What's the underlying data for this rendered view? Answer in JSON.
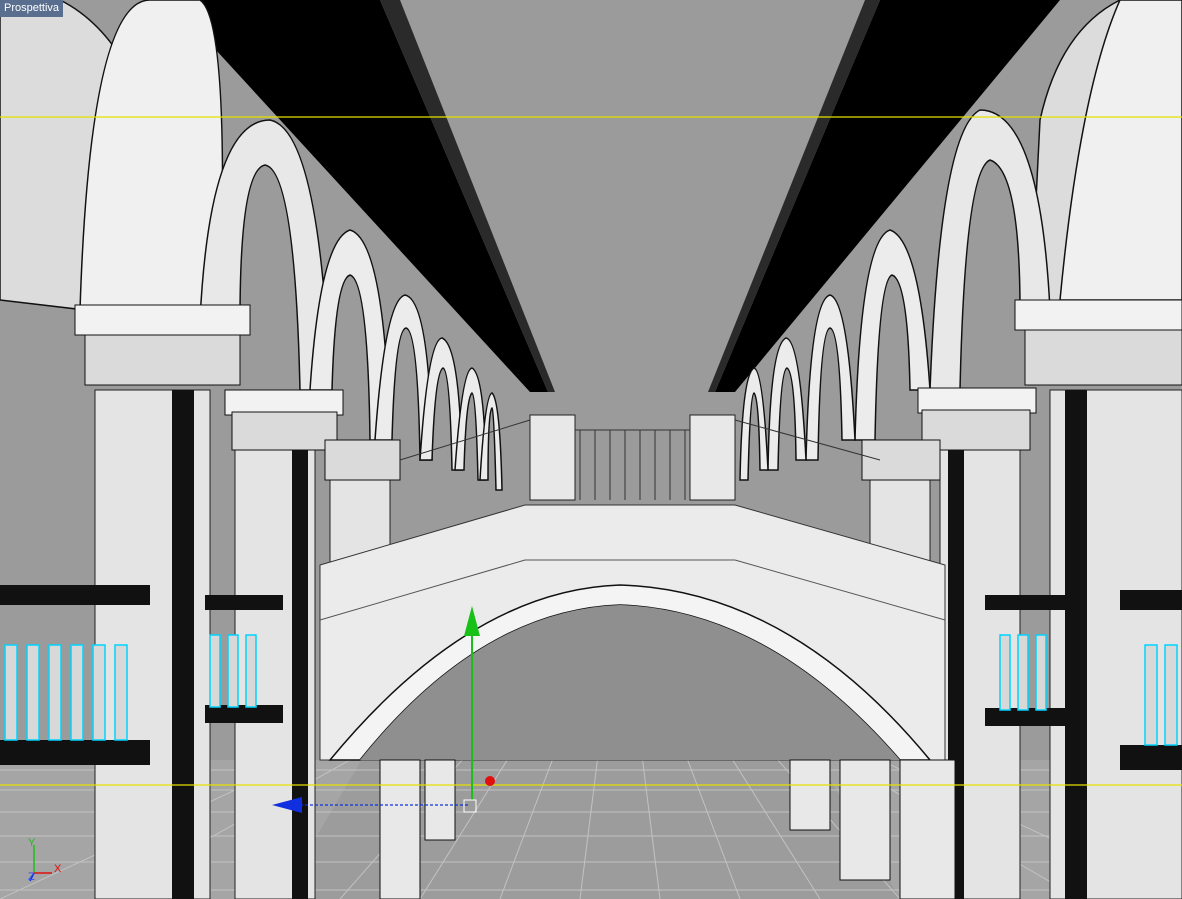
{
  "viewport": {
    "label": "Prospettiva",
    "background": "#9a9a9a",
    "safe_frame_color": "#e5e000"
  },
  "scene": {
    "ceiling_shadow": "#000000",
    "stone": "#e8e8e8",
    "grid_color": "#bdbdbd",
    "baluster_highlight": "#00d4ff"
  },
  "gizmo": {
    "y_axis_color": "#18c018",
    "x_axis_color": "#1030e0",
    "z_axis_color": "#e01010"
  },
  "axis_indicator": {
    "y_label": "Y",
    "z_label": "Z",
    "x_label": "X",
    "y_color": "#18c018",
    "z_color": "#1030e0",
    "x_color": "#e01010"
  }
}
